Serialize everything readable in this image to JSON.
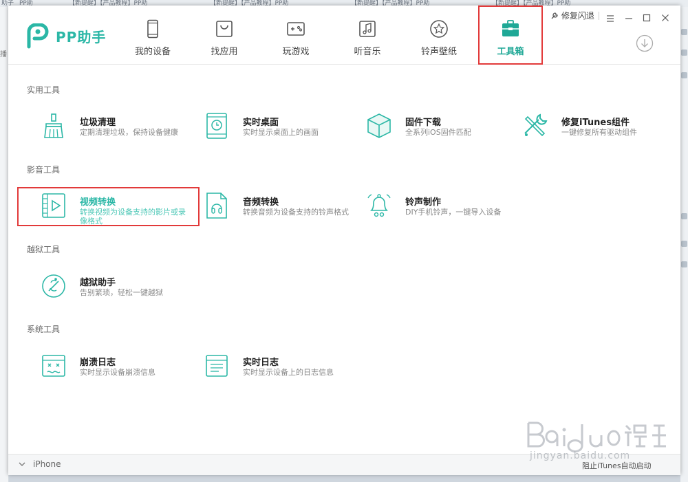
{
  "background": {
    "tabs": [
      "助子",
      "PP助",
      "【新提醒】【产品教程】PP助",
      "【新提醒】【产品教程】PP助",
      "【新提醒】【产品教程】PP助",
      "【新提醒】【产品教程】PP助"
    ],
    "left_strip_text": "播"
  },
  "app": {
    "brand": "PP助手",
    "window_controls": {
      "repair_label": "修复闪退",
      "menu_icon": "hamburger-icon",
      "minimize_icon": "minimize-icon",
      "maximize_icon": "maximize-icon",
      "close_icon": "close-icon"
    },
    "nav": [
      {
        "label": "我的设备",
        "icon": "phone-icon"
      },
      {
        "label": "找应用",
        "icon": "bag-icon"
      },
      {
        "label": "玩游戏",
        "icon": "gamepad-icon"
      },
      {
        "label": "听音乐",
        "icon": "music-icon"
      },
      {
        "label": "铃声壁纸",
        "icon": "star-icon"
      },
      {
        "label": "工具箱",
        "icon": "toolbox-icon",
        "active": true
      }
    ],
    "download_icon": "download-icon",
    "accent_color": "#2bb7a6",
    "highlight_color": "#e23a3a"
  },
  "sections": [
    {
      "title": "实用工具",
      "tools": [
        {
          "name": "垃圾清理",
          "desc": "定期清理垃圾，保持设备健康",
          "icon": "broom-icon"
        },
        {
          "name": "实时桌面",
          "desc": "实时显示桌面上的画面",
          "icon": "tablet-clock-icon"
        },
        {
          "name": "固件下载",
          "desc": "全系列iOS固件匹配",
          "icon": "cube-icon"
        },
        {
          "name": "修复iTunes组件",
          "desc": "一键修复所有驱动组件",
          "icon": "wrench-icon"
        }
      ]
    },
    {
      "title": "影音工具",
      "tools": [
        {
          "name": "视频转换",
          "desc": "转换视频为设备支持的影片或录像格式",
          "icon": "video-file-icon",
          "highlighted": true
        },
        {
          "name": "音频转换",
          "desc": "转换音频为设备支持的铃声格式",
          "icon": "audio-file-icon"
        },
        {
          "name": "铃声制作",
          "desc": "DIY手机铃声，一键导入设备",
          "icon": "bell-icon"
        }
      ]
    },
    {
      "title": "越狱工具",
      "tools": [
        {
          "name": "越狱助手",
          "desc": "告别繁琐，轻松一键越狱",
          "icon": "jailbreak-icon"
        }
      ]
    },
    {
      "title": "系统工具",
      "tools": [
        {
          "name": "崩溃日志",
          "desc": "实时显示设备崩溃信息",
          "icon": "crash-log-icon"
        },
        {
          "name": "实时日志",
          "desc": "实时显示设备上的日志信息",
          "icon": "realtime-log-icon"
        }
      ]
    }
  ],
  "footer": {
    "device_name": "iPhone",
    "itunes_text": "阻止iTunes自动启动"
  },
  "watermark": {
    "text": "jingyan.baidu.com"
  }
}
